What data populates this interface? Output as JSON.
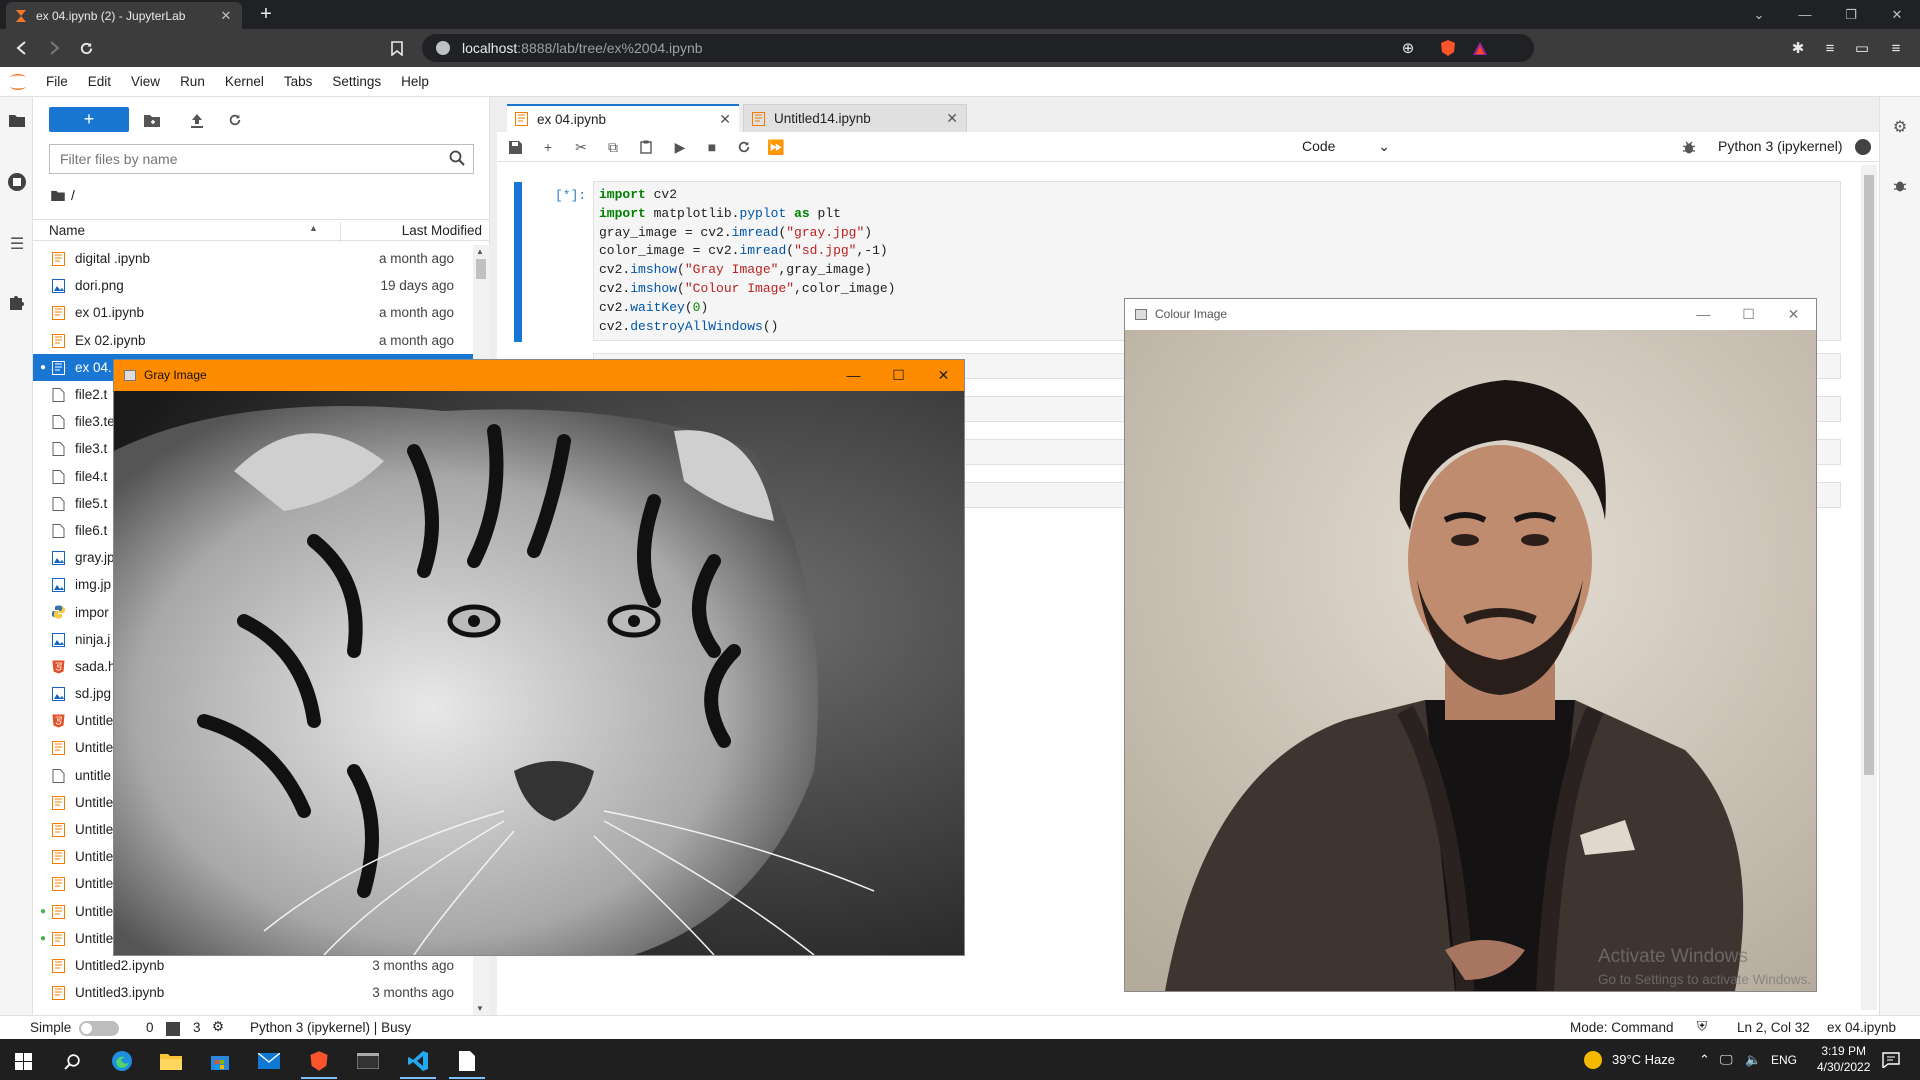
{
  "browser": {
    "tab_title": "ex 04.ipynb (2) - JupyterLab",
    "url_host": "localhost",
    "url_rest": ":8888/lab/tree/ex%2004.ipynb"
  },
  "menu": [
    "File",
    "Edit",
    "View",
    "Run",
    "Kernel",
    "Tabs",
    "Settings",
    "Help"
  ],
  "filebrowser": {
    "filter_placeholder": "Filter files by name",
    "breadcrumb": "/",
    "col_name": "Name",
    "col_modified": "Last Modified",
    "files": [
      {
        "name": "digital .ipynb",
        "modified": "a month ago",
        "type": "notebook",
        "running": false,
        "selected": false
      },
      {
        "name": "dori.png",
        "modified": "19 days ago",
        "type": "image",
        "running": false,
        "selected": false
      },
      {
        "name": "ex 01.ipynb",
        "modified": "a month ago",
        "type": "notebook",
        "running": false,
        "selected": false
      },
      {
        "name": "Ex 02.ipynb",
        "modified": "a month ago",
        "type": "notebook",
        "running": false,
        "selected": false
      },
      {
        "name": "ex 04.",
        "modified": "",
        "type": "notebook",
        "running": true,
        "selected": true
      },
      {
        "name": "file2.t",
        "modified": "",
        "type": "file",
        "running": false,
        "selected": false
      },
      {
        "name": "file3.te",
        "modified": "",
        "type": "file",
        "running": false,
        "selected": false
      },
      {
        "name": "file3.t",
        "modified": "",
        "type": "file",
        "running": false,
        "selected": false
      },
      {
        "name": "file4.t",
        "modified": "",
        "type": "file",
        "running": false,
        "selected": false
      },
      {
        "name": "file5.t",
        "modified": "",
        "type": "file",
        "running": false,
        "selected": false
      },
      {
        "name": "file6.t",
        "modified": "",
        "type": "file",
        "running": false,
        "selected": false
      },
      {
        "name": "gray.jp",
        "modified": "",
        "type": "image",
        "running": false,
        "selected": false
      },
      {
        "name": "img.jp",
        "modified": "",
        "type": "image",
        "running": false,
        "selected": false
      },
      {
        "name": "impor",
        "modified": "",
        "type": "python",
        "running": false,
        "selected": false
      },
      {
        "name": "ninja.j",
        "modified": "",
        "type": "image",
        "running": false,
        "selected": false
      },
      {
        "name": "sada.h",
        "modified": "",
        "type": "html",
        "running": false,
        "selected": false
      },
      {
        "name": "sd.jpg",
        "modified": "",
        "type": "image",
        "running": false,
        "selected": false
      },
      {
        "name": "Untitle",
        "modified": "",
        "type": "html",
        "running": false,
        "selected": false
      },
      {
        "name": "Untitle",
        "modified": "",
        "type": "notebook",
        "running": false,
        "selected": false
      },
      {
        "name": "untitle",
        "modified": "",
        "type": "file",
        "running": false,
        "selected": false
      },
      {
        "name": "Untitle",
        "modified": "",
        "type": "notebook",
        "running": false,
        "selected": false
      },
      {
        "name": "Untitle",
        "modified": "",
        "type": "notebook",
        "running": false,
        "selected": false
      },
      {
        "name": "Untitle",
        "modified": "",
        "type": "notebook",
        "running": false,
        "selected": false
      },
      {
        "name": "Untitle",
        "modified": "",
        "type": "notebook",
        "running": false,
        "selected": false
      },
      {
        "name": "Untitle",
        "modified": "",
        "type": "notebook",
        "running": true,
        "selected": false
      },
      {
        "name": "Untitle",
        "modified": "",
        "type": "notebook",
        "running": true,
        "selected": false
      },
      {
        "name": "Untitled2.ipynb",
        "modified": "3 months ago",
        "type": "notebook",
        "running": false,
        "selected": false
      },
      {
        "name": "Untitled3.ipynb",
        "modified": "3 months ago",
        "type": "notebook",
        "running": false,
        "selected": false
      }
    ]
  },
  "notebook": {
    "tabs": [
      {
        "label": "ex 04.ipynb",
        "active": true
      },
      {
        "label": "Untitled14.ipynb",
        "active": false
      }
    ],
    "cell_type": "Code",
    "kernel": "Python 3 (ipykernel)",
    "prompt": "[*]:",
    "code_lines": [
      [
        {
          "t": "import",
          "c": "kw"
        },
        {
          "t": " cv2",
          "c": ""
        }
      ],
      [
        {
          "t": "import",
          "c": "kw"
        },
        {
          "t": " matplotlib.",
          "c": ""
        },
        {
          "t": "pyplot",
          "c": "fn"
        },
        {
          "t": " ",
          "c": ""
        },
        {
          "t": "as",
          "c": "kw"
        },
        {
          "t": " plt",
          "c": ""
        }
      ],
      [
        {
          "t": "gray_image = cv2.",
          "c": ""
        },
        {
          "t": "imread",
          "c": "fn"
        },
        {
          "t": "(",
          "c": ""
        },
        {
          "t": "\"gray.jpg\"",
          "c": "str"
        },
        {
          "t": ")",
          "c": ""
        }
      ],
      [
        {
          "t": "color_image = cv2.",
          "c": ""
        },
        {
          "t": "imread",
          "c": "fn"
        },
        {
          "t": "(",
          "c": ""
        },
        {
          "t": "\"sd.jpg\"",
          "c": "str"
        },
        {
          "t": ",-1)",
          "c": ""
        }
      ],
      [
        {
          "t": "cv2.",
          "c": ""
        },
        {
          "t": "imshow",
          "c": "fn"
        },
        {
          "t": "(",
          "c": ""
        },
        {
          "t": "\"Gray Image\"",
          "c": "str"
        },
        {
          "t": ",gray_image)",
          "c": ""
        }
      ],
      [
        {
          "t": "cv2.",
          "c": ""
        },
        {
          "t": "imshow",
          "c": "fn"
        },
        {
          "t": "(",
          "c": ""
        },
        {
          "t": "\"Colour Image\"",
          "c": "str"
        },
        {
          "t": ",color_image)",
          "c": ""
        }
      ],
      [
        {
          "t": "cv2.",
          "c": ""
        },
        {
          "t": "waitKey",
          "c": "fn"
        },
        {
          "t": "(",
          "c": ""
        },
        {
          "t": "0",
          "c": "num"
        },
        {
          "t": ")",
          "c": ""
        }
      ],
      [
        {
          "t": "cv2.",
          "c": ""
        },
        {
          "t": "destroyAllWindows",
          "c": "fn"
        },
        {
          "t": "()",
          "c": ""
        }
      ]
    ]
  },
  "cv_windows": {
    "gray_title": "Gray Image",
    "colour_title": "Colour Image",
    "watermark_line1": "Activate Windows",
    "watermark_line2": "Go to Settings to activate Windows."
  },
  "statusbar": {
    "mode_label": "Simple",
    "terminals": "0",
    "kernels": "3",
    "kernel_status": "Python 3 (ipykernel) | Busy",
    "mode": "Mode: Command",
    "cursor": "Ln 2, Col 32",
    "filename": "ex 04.ipynb"
  },
  "taskbar": {
    "weather": "39°C  Haze",
    "lang": "ENG",
    "time": "3:19 PM",
    "date": "4/30/2022"
  },
  "colors": {
    "accent": "#1976d2",
    "gray_window_border": "#ff8c00",
    "notebook_icon": "#f57c00",
    "image_icon": "#1565c0"
  }
}
